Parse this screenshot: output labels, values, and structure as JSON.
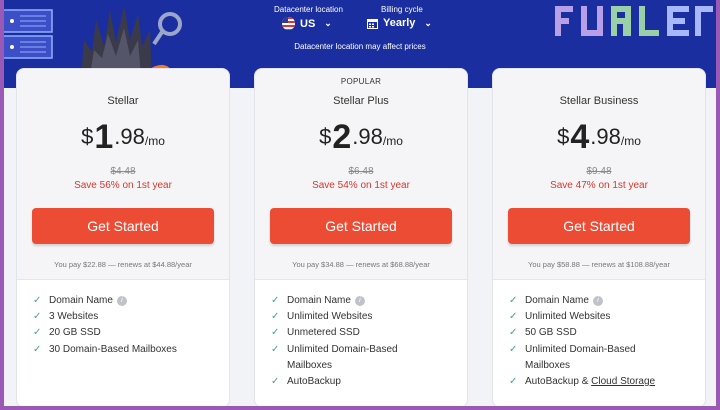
{
  "header": {
    "location_label": "Datacenter location",
    "location_value": "US",
    "billing_label": "Billing cycle",
    "billing_value": "Yearly",
    "note": "Datacenter location may affect prices"
  },
  "plans": [
    {
      "badge": "",
      "name": "Stellar",
      "currency": "$",
      "whole": "1",
      "cents": ".98",
      "per": "/mo",
      "old_price": "$4.48",
      "save": "Save 56% on 1st year",
      "cta": "Get Started",
      "renew": "You pay $22.88 — renews at $44.88/year",
      "features": [
        "Domain Name",
        "3 Websites",
        "20 GB SSD",
        "30 Domain-Based Mailboxes"
      ]
    },
    {
      "badge": "POPULAR",
      "name": "Stellar Plus",
      "currency": "$",
      "whole": "2",
      "cents": ".98",
      "per": "/mo",
      "old_price": "$6.48",
      "save": "Save 54% on 1st year",
      "cta": "Get Started",
      "renew": "You pay $34.88 — renews at $68.88/year",
      "features": [
        "Domain Name",
        "Unlimited Websites",
        "Unmetered SSD",
        "Unlimited Domain-Based",
        "Mailboxes",
        "AutoBackup"
      ]
    },
    {
      "badge": "",
      "name": "Stellar Business",
      "currency": "$",
      "whole": "4",
      "cents": ".98",
      "per": "/mo",
      "old_price": "$9.48",
      "save": "Save 47% on 1st year",
      "cta": "Get Started",
      "renew": "You pay $58.88 — renews at $108.88/year",
      "features": [
        "Domain Name",
        "Unlimited Websites",
        "50 GB SSD",
        "Unlimited Domain-Based",
        "Mailboxes"
      ],
      "extra_feature": {
        "text": "AutoBackup & ",
        "link": "Cloud Storage"
      }
    }
  ],
  "icons": {
    "check": "check-icon",
    "info": "info-icon",
    "flag": "us-flag-icon",
    "calendar": "calendar-icon",
    "chevron": "chevron-down-icon"
  },
  "colors": {
    "hero": "#1a2ea0",
    "accent": "#ec4c34",
    "save": "#d8372a",
    "check": "#4aa08a",
    "border": "#9b59b6"
  }
}
